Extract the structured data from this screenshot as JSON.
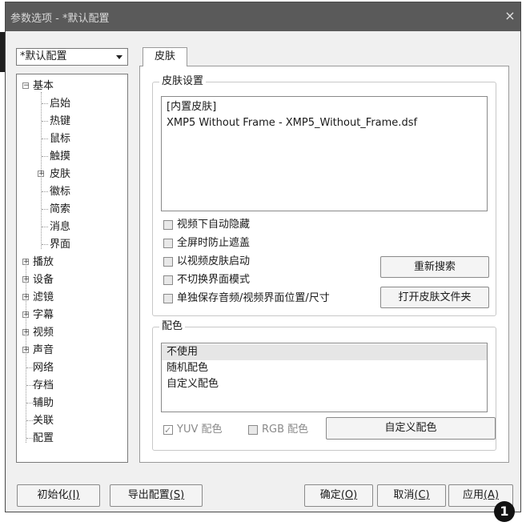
{
  "window": {
    "title": "参数选项 - *默认配置",
    "close_glyph": "×"
  },
  "profile_select": {
    "value": "*默认配置"
  },
  "tree": {
    "root": {
      "label": "基本",
      "expander": "−"
    },
    "root_children": [
      "启始",
      "热键",
      "鼠标",
      "触摸",
      "皮肤",
      "徽标",
      "简索",
      "消息",
      "界面"
    ],
    "skin_expander": "+",
    "top_items": [
      {
        "label": "播放",
        "expander": "+"
      },
      {
        "label": "设备",
        "expander": "+"
      },
      {
        "label": "滤镜",
        "expander": "+"
      },
      {
        "label": "字幕",
        "expander": "+"
      },
      {
        "label": "视频",
        "expander": "+"
      },
      {
        "label": "声音",
        "expander": "+"
      },
      {
        "label": "网络",
        "expander": ""
      },
      {
        "label": "存档",
        "expander": ""
      },
      {
        "label": "辅助",
        "expander": ""
      },
      {
        "label": "关联",
        "expander": ""
      },
      {
        "label": "配置",
        "expander": ""
      }
    ]
  },
  "tabs": [
    {
      "label": "皮肤"
    }
  ],
  "skin_settings": {
    "title": "皮肤设置",
    "list": [
      "[内置皮肤]",
      "XMP5 Without Frame - XMP5_Without_Frame.dsf"
    ],
    "options": [
      {
        "label": "视频下自动隐藏",
        "checked": false
      },
      {
        "label": "全屏时防止遮盖",
        "checked": false
      },
      {
        "label": "以视频皮肤启动",
        "checked": false
      },
      {
        "label": "不切换界面模式",
        "checked": false
      },
      {
        "label": "单独保存音频/视频界面位置/尺寸",
        "checked": false
      }
    ],
    "rescan_button": "重新搜索",
    "open_folder_button": "打开皮肤文件夹"
  },
  "color_scheme": {
    "title": "配色",
    "list": [
      "不使用",
      "随机配色",
      "自定义配色"
    ],
    "selected_index": 0,
    "yuv": {
      "label": "YUV 配色",
      "checked": true
    },
    "rgb": {
      "label": "RGB 配色",
      "checked": false
    },
    "custom_button": "自定义配色"
  },
  "footer": {
    "init_label": "初始化",
    "init_key": "(I)",
    "export_label": "导出配置",
    "export_key": "(S)",
    "ok_label": "确定",
    "ok_key": "(O)",
    "cancel_label": "取消",
    "cancel_key": "(C)",
    "apply_label": "应用",
    "apply_key": "(A)"
  },
  "annotation_badge": "1"
}
